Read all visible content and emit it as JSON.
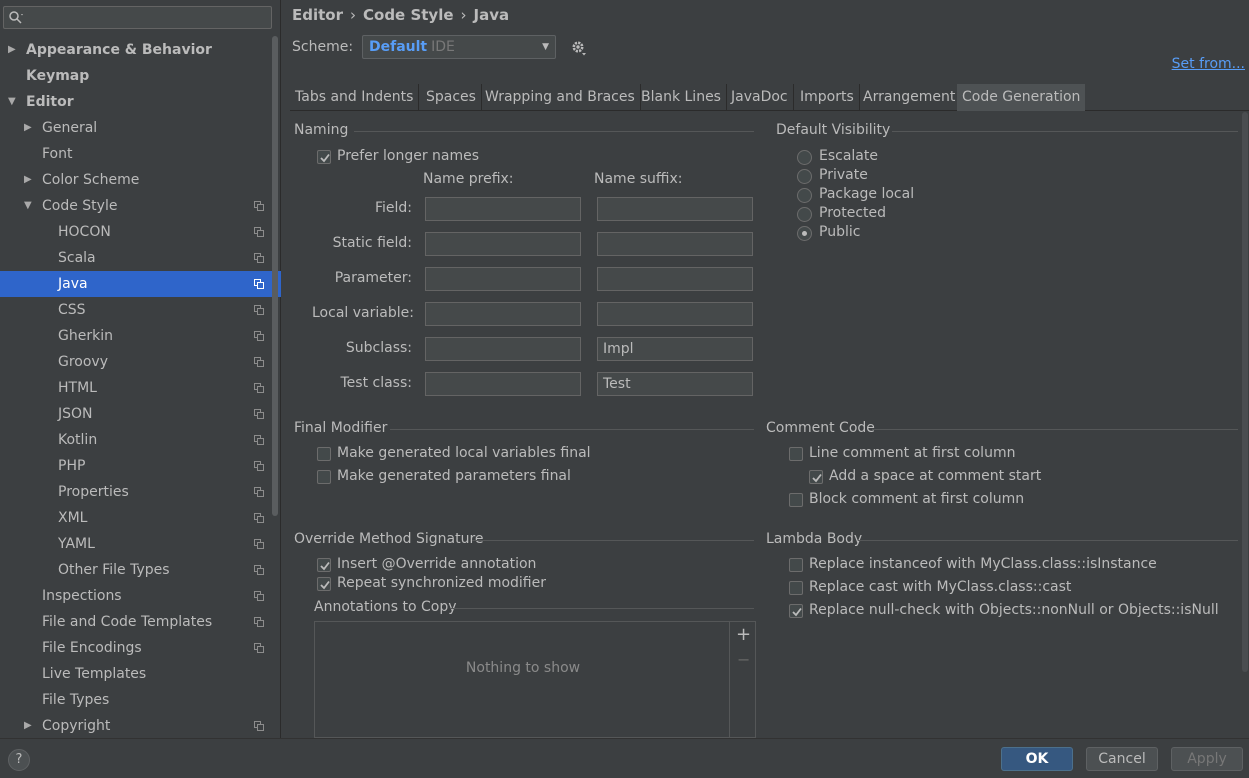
{
  "sidebar": {
    "items": [
      {
        "label": "Appearance & Behavior",
        "level": 0,
        "arrow": "right",
        "bold": true,
        "copy": false
      },
      {
        "label": "Keymap",
        "level": 0,
        "arrow": "none",
        "bold": true,
        "copy": false
      },
      {
        "label": "Editor",
        "level": 0,
        "arrow": "down",
        "bold": true,
        "copy": false
      },
      {
        "label": "General",
        "level": 1,
        "arrow": "right",
        "bold": false,
        "copy": false
      },
      {
        "label": "Font",
        "level": 1,
        "arrow": "none",
        "bold": false,
        "copy": false
      },
      {
        "label": "Color Scheme",
        "level": 1,
        "arrow": "right",
        "bold": false,
        "copy": false
      },
      {
        "label": "Code Style",
        "level": 1,
        "arrow": "down",
        "bold": false,
        "copy": true
      },
      {
        "label": "HOCON",
        "level": 2,
        "arrow": "none",
        "bold": false,
        "copy": true
      },
      {
        "label": "Scala",
        "level": 2,
        "arrow": "none",
        "bold": false,
        "copy": true
      },
      {
        "label": "Java",
        "level": 2,
        "arrow": "none",
        "bold": false,
        "copy": true,
        "selected": true
      },
      {
        "label": "CSS",
        "level": 2,
        "arrow": "none",
        "bold": false,
        "copy": true
      },
      {
        "label": "Gherkin",
        "level": 2,
        "arrow": "none",
        "bold": false,
        "copy": true
      },
      {
        "label": "Groovy",
        "level": 2,
        "arrow": "none",
        "bold": false,
        "copy": true
      },
      {
        "label": "HTML",
        "level": 2,
        "arrow": "none",
        "bold": false,
        "copy": true
      },
      {
        "label": "JSON",
        "level": 2,
        "arrow": "none",
        "bold": false,
        "copy": true
      },
      {
        "label": "Kotlin",
        "level": 2,
        "arrow": "none",
        "bold": false,
        "copy": true
      },
      {
        "label": "PHP",
        "level": 2,
        "arrow": "none",
        "bold": false,
        "copy": true
      },
      {
        "label": "Properties",
        "level": 2,
        "arrow": "none",
        "bold": false,
        "copy": true
      },
      {
        "label": "XML",
        "level": 2,
        "arrow": "none",
        "bold": false,
        "copy": true
      },
      {
        "label": "YAML",
        "level": 2,
        "arrow": "none",
        "bold": false,
        "copy": true
      },
      {
        "label": "Other File Types",
        "level": 2,
        "arrow": "none",
        "bold": false,
        "copy": true
      },
      {
        "label": "Inspections",
        "level": 1,
        "arrow": "none",
        "bold": false,
        "copy": true
      },
      {
        "label": "File and Code Templates",
        "level": 1,
        "arrow": "none",
        "bold": false,
        "copy": true
      },
      {
        "label": "File Encodings",
        "level": 1,
        "arrow": "none",
        "bold": false,
        "copy": true
      },
      {
        "label": "Live Templates",
        "level": 1,
        "arrow": "none",
        "bold": false,
        "copy": false
      },
      {
        "label": "File Types",
        "level": 1,
        "arrow": "none",
        "bold": false,
        "copy": false
      },
      {
        "label": "Copyright",
        "level": 1,
        "arrow": "right",
        "bold": false,
        "copy": true
      }
    ]
  },
  "breadcrumb": {
    "a": "Editor",
    "b": "Code Style",
    "c": "Java",
    "sep": "›"
  },
  "scheme": {
    "label": "Scheme:",
    "name": "Default",
    "type": "IDE"
  },
  "set_from": "Set from...",
  "tabs": [
    "Tabs and Indents",
    "Spaces",
    "Wrapping and Braces",
    "Blank Lines",
    "JavaDoc",
    "Imports",
    "Arrangement",
    "Code Generation"
  ],
  "naming": {
    "title": "Naming",
    "prefer_longer": "Prefer longer names",
    "prefix_header": "Name prefix:",
    "suffix_header": "Name suffix:",
    "rows": [
      {
        "label": "Field:",
        "prefix": "",
        "suffix": ""
      },
      {
        "label": "Static field:",
        "prefix": "",
        "suffix": ""
      },
      {
        "label": "Parameter:",
        "prefix": "",
        "suffix": ""
      },
      {
        "label": "Local variable:",
        "prefix": "",
        "suffix": ""
      },
      {
        "label": "Subclass:",
        "prefix": "",
        "suffix": "Impl"
      },
      {
        "label": "Test class:",
        "prefix": "",
        "suffix": "Test"
      }
    ]
  },
  "visibility": {
    "title": "Default Visibility",
    "options": [
      "Escalate",
      "Private",
      "Package local",
      "Protected",
      "Public"
    ],
    "selected": "Public"
  },
  "final_modifier": {
    "title": "Final Modifier",
    "local_vars": "Make generated local variables final",
    "params": "Make generated parameters final"
  },
  "comment_code": {
    "title": "Comment Code",
    "line_first": "Line comment at first column",
    "add_space": "Add a space at comment start",
    "block_first": "Block comment at first column"
  },
  "override": {
    "title": "Override Method Signature",
    "insert": "Insert @Override annotation",
    "repeat_sync": "Repeat synchronized modifier",
    "annotations_title": "Annotations to Copy",
    "empty": "Nothing to show",
    "add": "+",
    "remove": "−"
  },
  "lambda": {
    "title": "Lambda Body",
    "instanceof": "Replace instanceof with MyClass.class::isInstance",
    "cast": "Replace cast with MyClass.class::cast",
    "nullcheck": "Replace null-check with Objects::nonNull or Objects::isNull"
  },
  "buttons": {
    "help": "?",
    "ok": "OK",
    "cancel": "Cancel",
    "apply": "Apply"
  },
  "colors": {
    "selection": "#2f65ca",
    "link": "#589df6",
    "primary": "#365880",
    "bg": "#3c3f41"
  }
}
